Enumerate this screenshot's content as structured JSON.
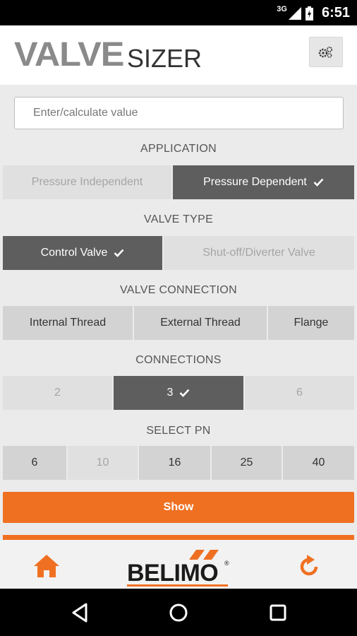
{
  "status_bar": {
    "network": "3G",
    "time": "6:51"
  },
  "app_bar": {
    "logo_main": "VALVE",
    "logo_sub": "SIZER",
    "settings_icon": "gears-icon"
  },
  "value_input": {
    "placeholder": "Enter/calculate value",
    "value": ""
  },
  "application": {
    "title": "APPLICATION",
    "options": [
      {
        "label": "Pressure Independent",
        "state": "disabled"
      },
      {
        "label": "Pressure Dependent",
        "state": "selected"
      }
    ]
  },
  "valve_type": {
    "title": "VALVE TYPE",
    "options": [
      {
        "label": "Control Valve",
        "state": "selected"
      },
      {
        "label": "Shut-off/Diverter Valve",
        "state": "disabled"
      }
    ]
  },
  "valve_connection": {
    "title": "VALVE CONNECTION",
    "options": [
      {
        "label": "Internal Thread",
        "state": "normal"
      },
      {
        "label": "External Thread",
        "state": "normal"
      },
      {
        "label": "Flange",
        "state": "normal"
      }
    ]
  },
  "connections": {
    "title": "CONNECTIONS",
    "options": [
      {
        "label": "2",
        "state": "disabled"
      },
      {
        "label": "3",
        "state": "selected"
      },
      {
        "label": "6",
        "state": "disabled"
      }
    ]
  },
  "select_pn": {
    "title": "SELECT PN",
    "options": [
      {
        "label": "6",
        "state": "normal"
      },
      {
        "label": "10",
        "state": "disabled"
      },
      {
        "label": "16",
        "state": "normal"
      },
      {
        "label": "25",
        "state": "normal"
      },
      {
        "label": "40",
        "state": "normal"
      }
    ]
  },
  "show_button": {
    "label": "Show"
  },
  "bottom_bar": {
    "brand": "BELIMO",
    "registered_mark": "®",
    "accent_color": "#f07022"
  },
  "colors": {
    "accent": "#f07022",
    "selected": "#5e5e5e",
    "option": "#d3d3d3",
    "disabled_option": "#e0e0e0"
  }
}
